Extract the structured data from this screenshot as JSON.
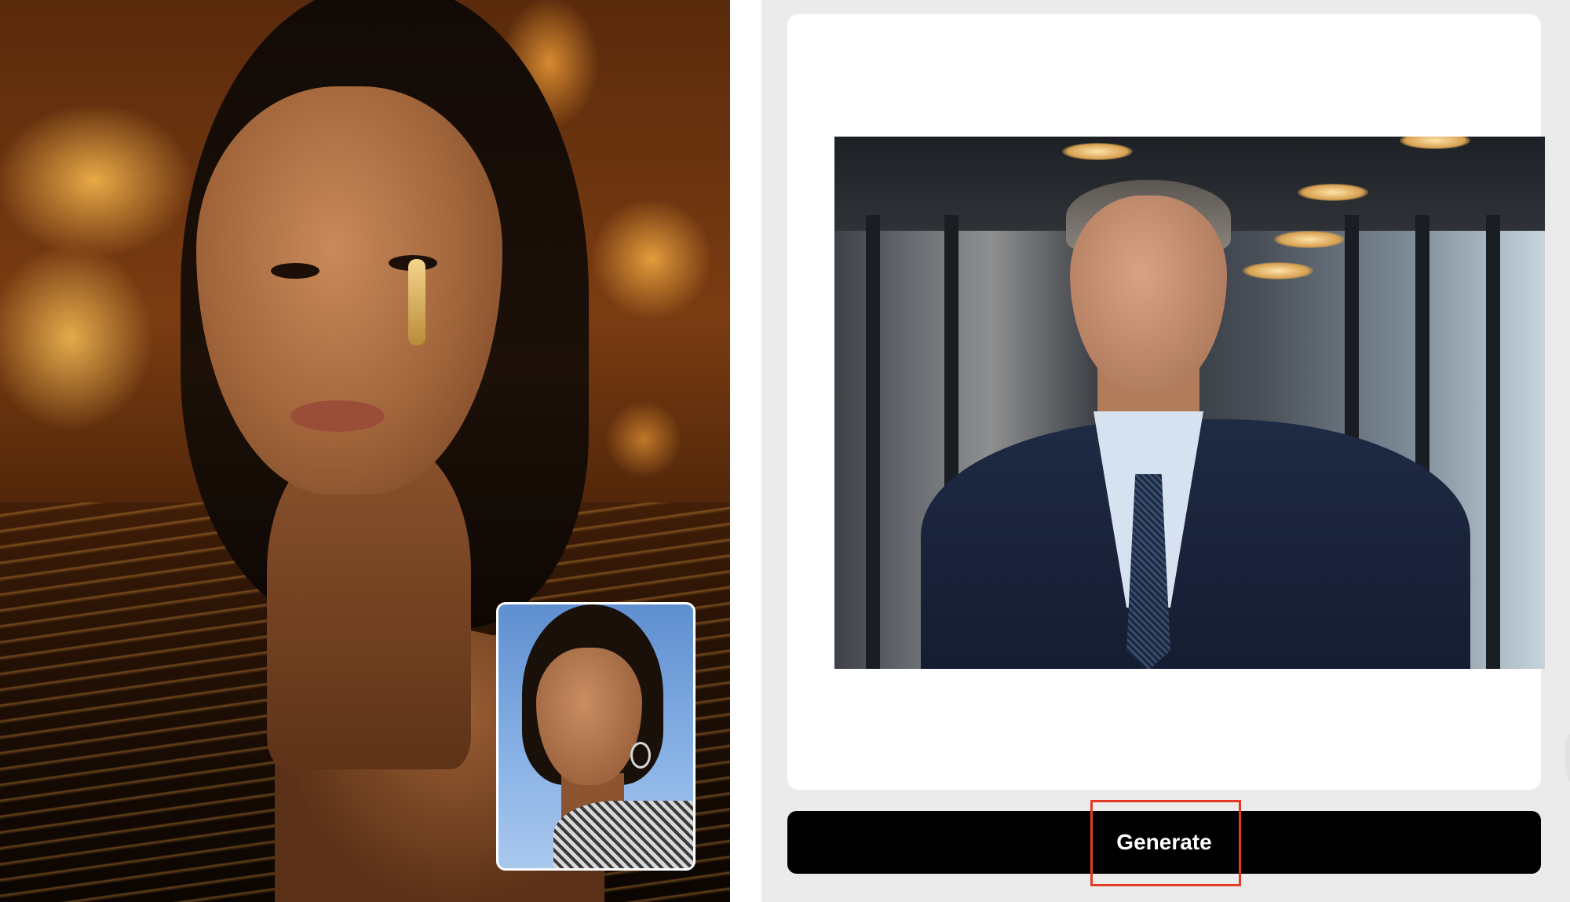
{
  "result_panel": {
    "main_image": "generated-portrait-woman-in-water-with-bokeh-fire-lights",
    "reference_image": "source-face-woman-against-blue-sky"
  },
  "control_panel": {
    "preview_image": "target-photo-man-in-navy-suit-office-corridor",
    "generate_label": "Generate"
  },
  "colors": {
    "panel_background": "#ebebeb",
    "card_background": "#ffffff",
    "button_background": "#000000",
    "button_text": "#ffffff",
    "highlight_border": "#e53924"
  }
}
